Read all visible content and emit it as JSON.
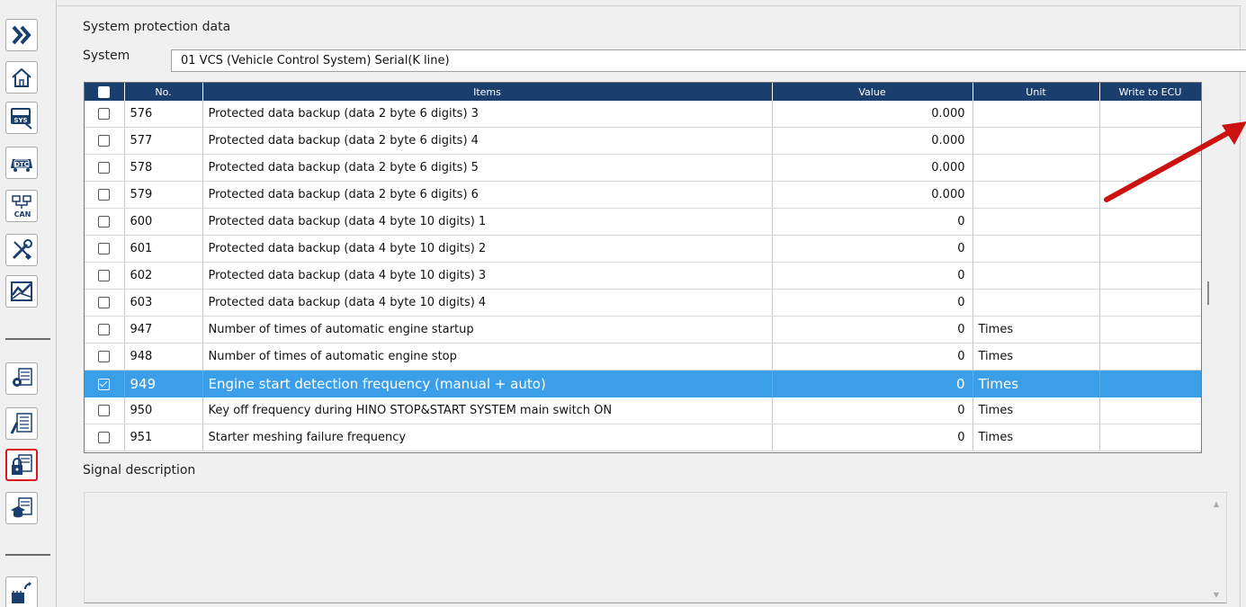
{
  "sidebar": {
    "items": [
      {
        "name": "expand-icon"
      },
      {
        "name": "home-icon"
      },
      {
        "name": "system-icon",
        "label": "SYS"
      },
      {
        "name": "dtc-icon",
        "label": "DTC"
      },
      {
        "name": "can-icon",
        "label": "CAN"
      },
      {
        "name": "tools-icon"
      },
      {
        "name": "graph-icon"
      },
      {
        "name": "settings-list-icon"
      },
      {
        "name": "edit-list-icon"
      },
      {
        "name": "lock-list-icon",
        "active": true
      },
      {
        "name": "education-list-icon"
      },
      {
        "name": "ecu-refresh-icon"
      }
    ]
  },
  "main": {
    "section_title": "System protection data",
    "system_label": "System",
    "system_value": "01  VCS (Vehicle Control System)  Serial(K line)",
    "table": {
      "headers": [
        "No.",
        "Items",
        "Value",
        "Unit",
        "Write to ECU"
      ],
      "rows": [
        {
          "no": "576",
          "item": "Protected data backup (data 2 byte 6 digits) 3",
          "value": "0.000",
          "unit": "",
          "checked": false
        },
        {
          "no": "577",
          "item": "Protected data backup (data 2 byte 6 digits) 4",
          "value": "0.000",
          "unit": "",
          "checked": false
        },
        {
          "no": "578",
          "item": "Protected data backup (data 2 byte 6 digits) 5",
          "value": "0.000",
          "unit": "",
          "checked": false
        },
        {
          "no": "579",
          "item": "Protected data backup (data 2 byte 6 digits) 6",
          "value": "0.000",
          "unit": "",
          "checked": false
        },
        {
          "no": "600",
          "item": "Protected data backup (data 4 byte 10 digits) 1",
          "value": "0",
          "unit": "",
          "checked": false
        },
        {
          "no": "601",
          "item": "Protected data backup (data 4 byte 10 digits) 2",
          "value": "0",
          "unit": "",
          "checked": false
        },
        {
          "no": "602",
          "item": "Protected data backup (data 4 byte 10 digits) 3",
          "value": "0",
          "unit": "",
          "checked": false
        },
        {
          "no": "603",
          "item": "Protected data backup (data 4 byte 10 digits) 4",
          "value": "0",
          "unit": "",
          "checked": false
        },
        {
          "no": "947",
          "item": "Number of times of automatic engine startup",
          "value": "0",
          "unit": "Times",
          "checked": false
        },
        {
          "no": "948",
          "item": "Number of times of automatic engine stop",
          "value": "0",
          "unit": "Times",
          "checked": false
        },
        {
          "no": "949",
          "item": "Engine start detection frequency (manual + auto)",
          "value": "0",
          "unit": "Times",
          "checked": true,
          "selected": true
        },
        {
          "no": "950",
          "item": "Key off frequency during HINO STOP&START SYSTEM main switch ON",
          "value": "0",
          "unit": "Times",
          "checked": false
        },
        {
          "no": "951",
          "item": "Starter meshing failure frequency",
          "value": "0",
          "unit": "Times",
          "checked": false
        }
      ]
    },
    "signal_label": "Signal description",
    "signal_text": ""
  },
  "colors": {
    "header_bg": "#1a3e6e",
    "selection": "#3a9ee8",
    "annotation_arrow": "#cc1111",
    "active_outline": "#d9161e"
  }
}
